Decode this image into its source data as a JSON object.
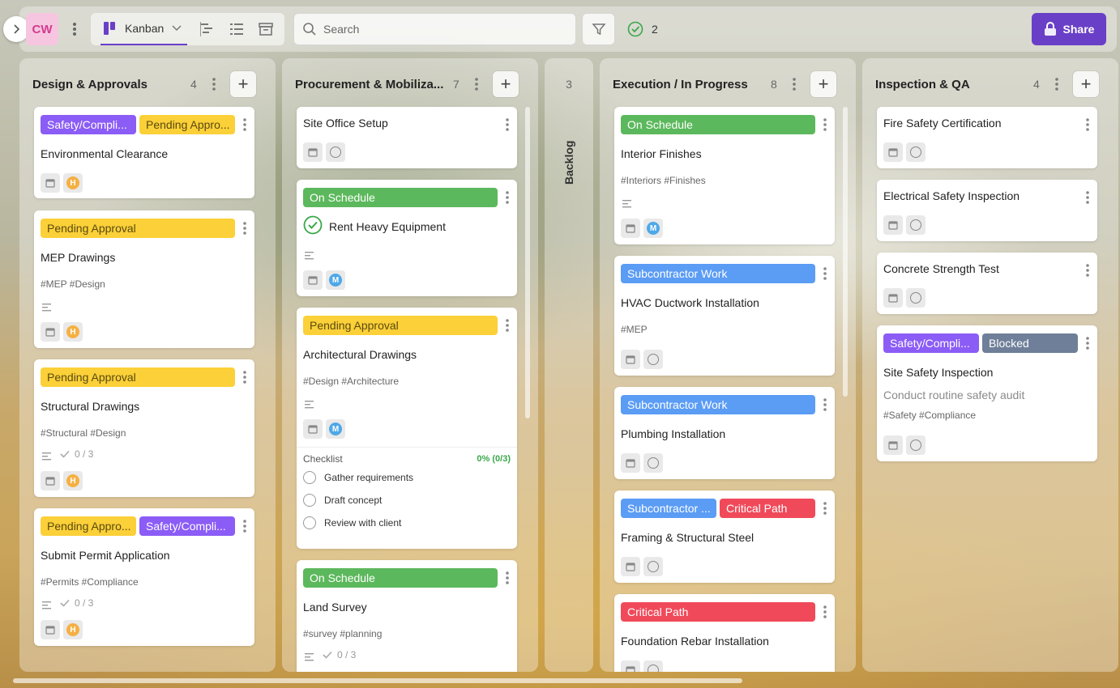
{
  "topbar": {
    "workspace_initials": "CW",
    "view_label": "Kanban",
    "search_placeholder": "Search",
    "done_count": "2",
    "share_label": "Share"
  },
  "colors": {
    "accent": "#6a3fc7",
    "tag_purple": "#8b5cf6",
    "tag_yellow": "#fbd038",
    "tag_green": "#5cb85c",
    "tag_blue": "#5b9cf5",
    "tag_red": "#f04a5a",
    "tag_slate": "#6f7f99",
    "avatar_h": "#f5b042",
    "avatar_m": "#4ea8e8"
  },
  "columns": [
    {
      "title": "Design & Approvals",
      "count": "4",
      "cards": [
        {
          "tags": [
            "Safety/Compli...",
            "Pending Appro..."
          ],
          "title": "Environmental Clearance",
          "assignee": "H"
        },
        {
          "tags": [
            "Pending Approval"
          ],
          "title": "MEP Drawings",
          "hashtags": "#MEP #Design",
          "assignee": "H"
        },
        {
          "tags": [
            "Pending Approval"
          ],
          "title": "Structural Drawings",
          "hashtags": "#Structural #Design",
          "checklist": "0 / 3",
          "assignee": "H"
        },
        {
          "tags": [
            "Pending Appro...",
            "Safety/Compli..."
          ],
          "title": "Submit Permit Application",
          "hashtags": "#Permits #Compliance",
          "checklist": "0 / 3",
          "assignee": "H"
        }
      ]
    },
    {
      "title": "Procurement & Mobiliza...",
      "count": "7",
      "cards": [
        {
          "title": "Site Office Setup"
        },
        {
          "tags": [
            "On Schedule"
          ],
          "title": "Rent Heavy Equipment",
          "assignee": "M"
        },
        {
          "tags": [
            "Pending Approval"
          ],
          "title": "Architectural Drawings",
          "hashtags": "#Design #Architecture",
          "assignee": "M",
          "checklist_title": "Checklist",
          "checklist_pct": "0% (0/3)",
          "checklist_items": [
            "Gather requirements",
            "Draft concept",
            "Review with client"
          ]
        },
        {
          "tags": [
            "On Schedule"
          ],
          "title": "Land Survey",
          "hashtags": "#survey #planning",
          "checklist": "0 / 3"
        }
      ]
    },
    {
      "title": "Backlog",
      "count": "3"
    },
    {
      "title": "Execution / In Progress",
      "count": "8",
      "cards": [
        {
          "tags": [
            "On Schedule"
          ],
          "title": "Interior Finishes",
          "hashtags": "#Interiors #Finishes",
          "assignee": "M"
        },
        {
          "tags": [
            "Subcontractor Work"
          ],
          "title": "HVAC Ductwork Installation",
          "hashtags": "#MEP"
        },
        {
          "tags": [
            "Subcontractor Work"
          ],
          "title": "Plumbing Installation"
        },
        {
          "tags": [
            "Subcontractor ...",
            "Critical Path"
          ],
          "title": "Framing & Structural Steel"
        },
        {
          "tags": [
            "Critical Path"
          ],
          "title": "Foundation Rebar Installation"
        }
      ]
    },
    {
      "title": "Inspection & QA",
      "count": "4",
      "cards": [
        {
          "title": "Fire Safety Certification"
        },
        {
          "title": "Electrical Safety Inspection"
        },
        {
          "title": "Concrete Strength Test"
        },
        {
          "tags": [
            "Safety/Compli...",
            "Blocked"
          ],
          "title": "Site Safety Inspection",
          "description": "Conduct routine safety audit",
          "hashtags": "#Safety #Compliance"
        }
      ]
    }
  ]
}
